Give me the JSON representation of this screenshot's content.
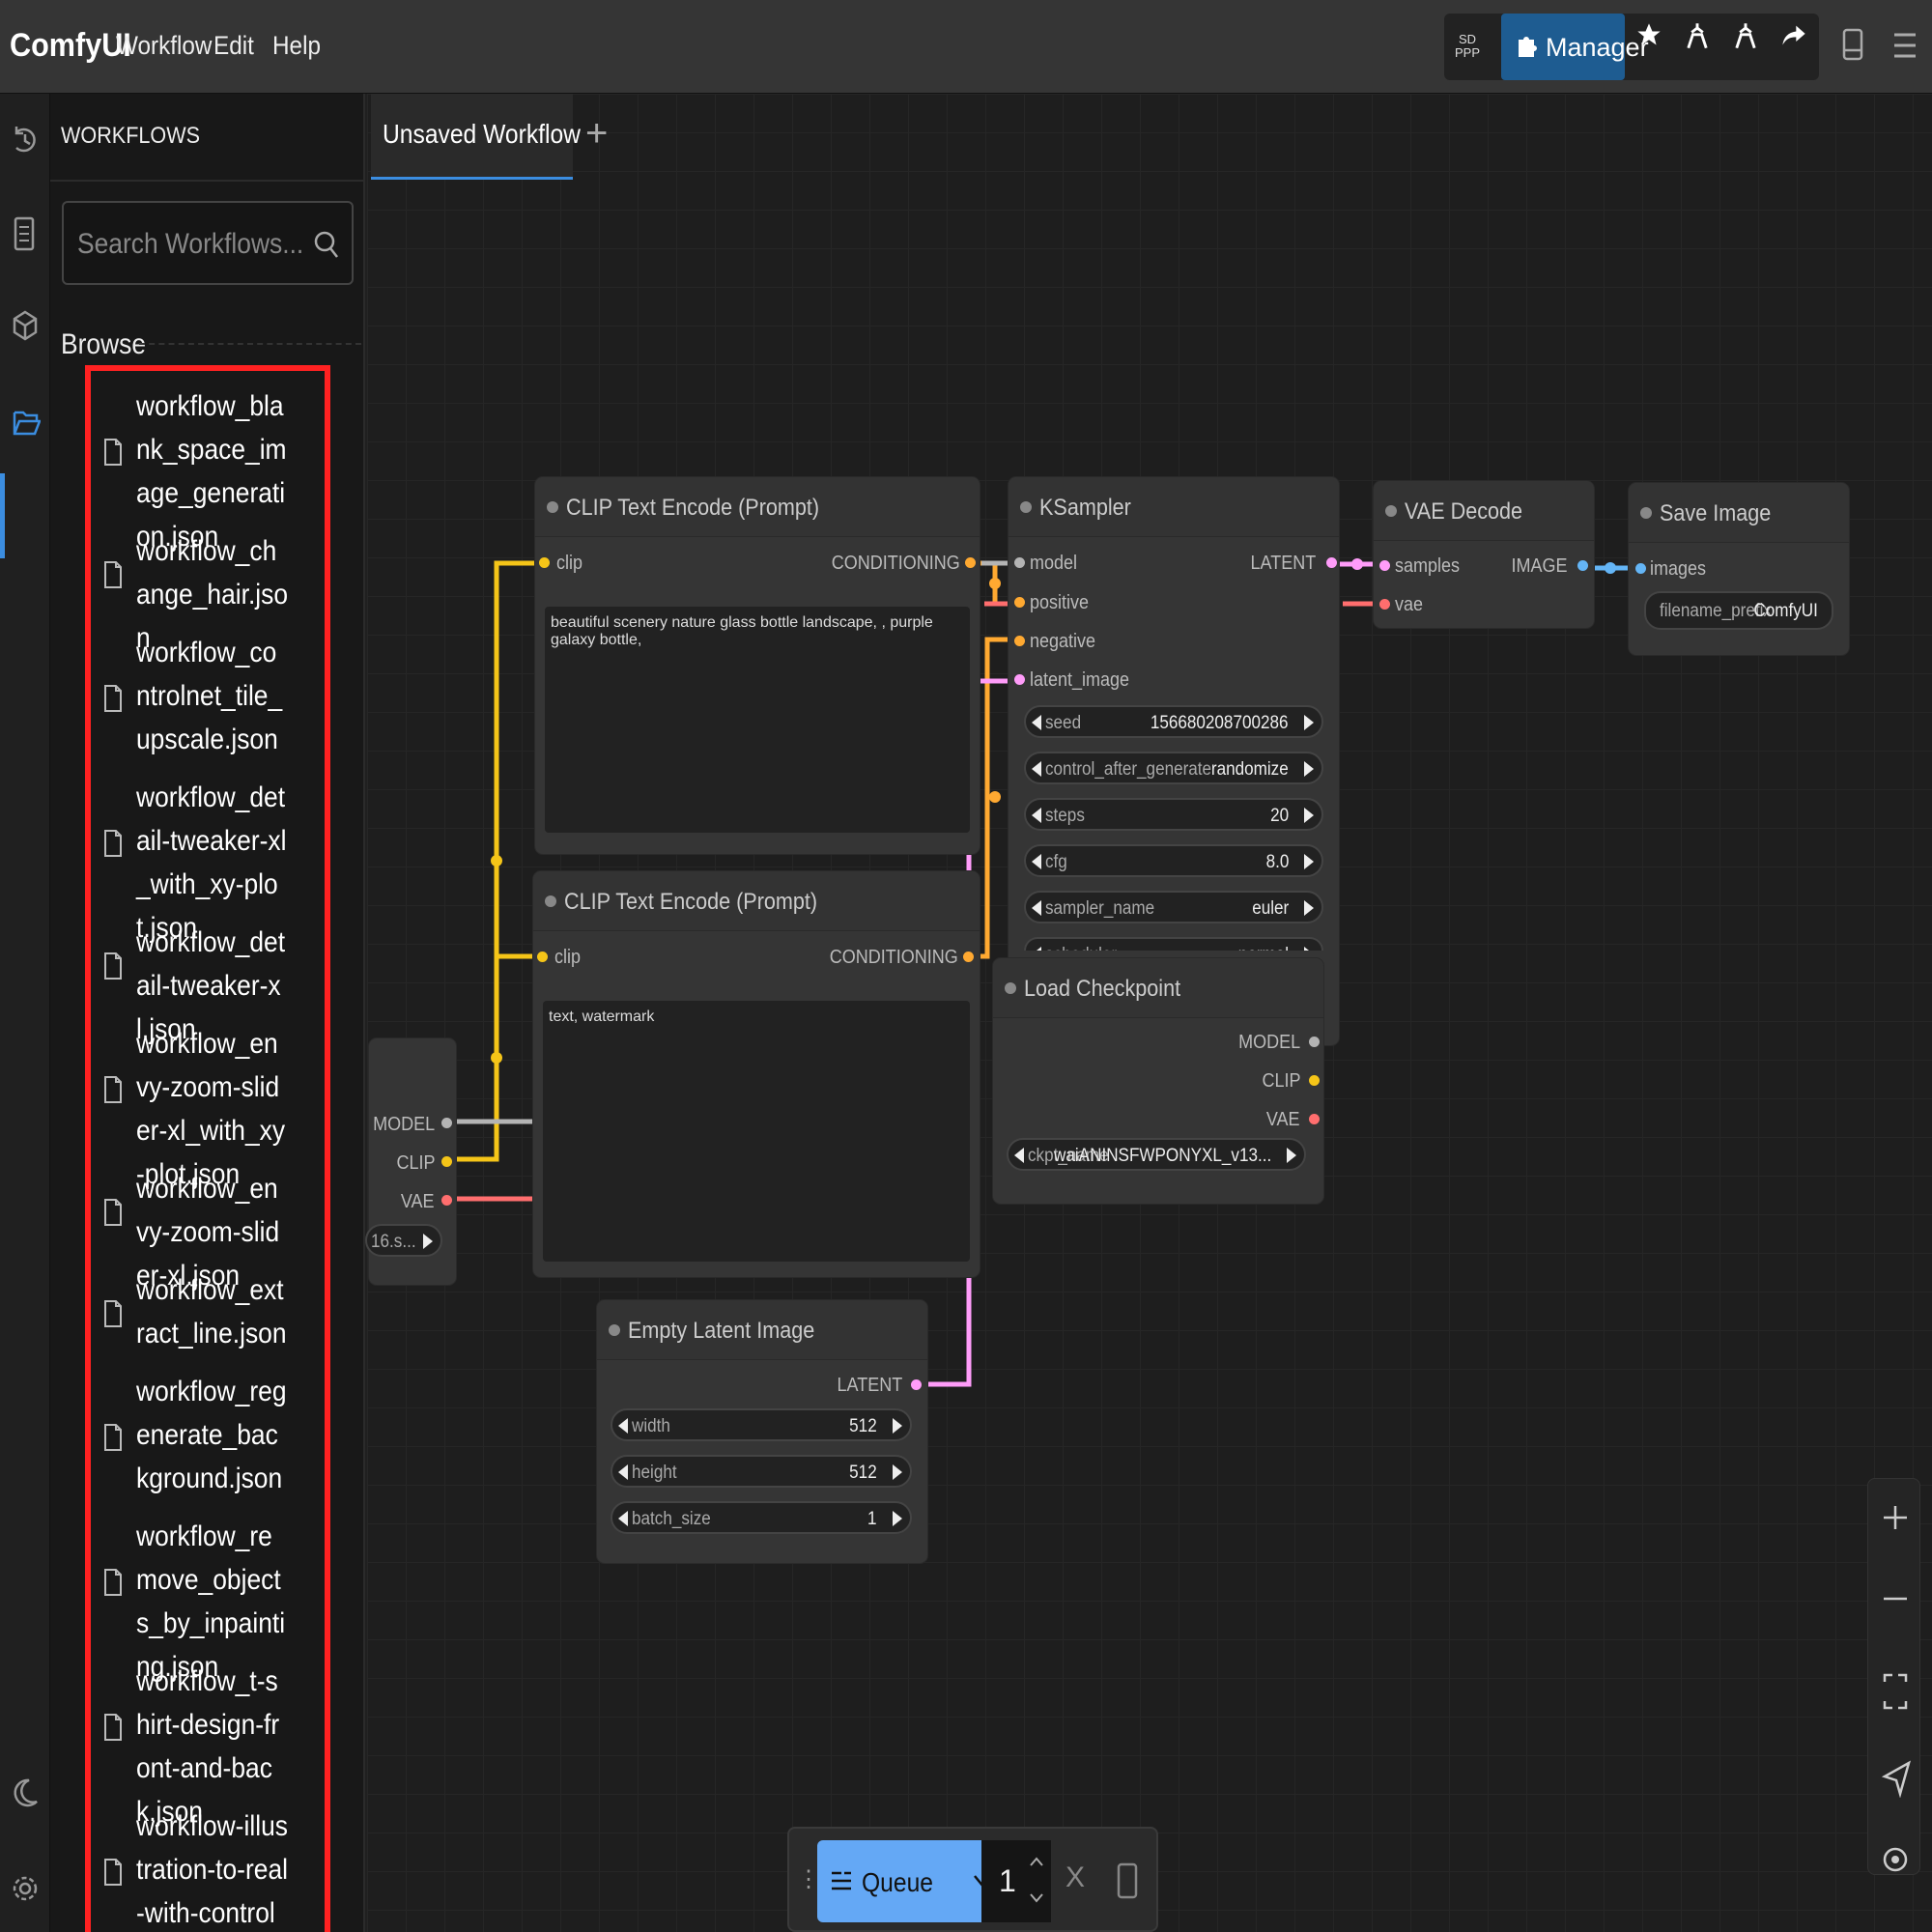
{
  "app": {
    "title": "ComfyUI"
  },
  "menu": {
    "workflow": "Workflow",
    "edit": "Edit",
    "help": "Help"
  },
  "toolbar": {
    "sdppp": "SD PPP",
    "manager": "Manager"
  },
  "sidebar": {
    "title": "WORKFLOWS",
    "search_placeholder": "Search Workflows...",
    "browse_label": "Browse",
    "workflows": [
      "workflow_blank_space_image_generation.json",
      "workflow_change_hair.json",
      "workflow_controlnet_tile_upscale.json",
      "workflow_detail-tweaker-xl_with_xy-plot.json",
      "workflow_detail-tweaker-xl.json",
      "workflow_envy-zoom-slider-xl_with_xy-plot.json",
      "workflow_envy-zoom-slider-xl.json",
      "workflow_extract_line.json",
      "workflow_regenerate_background.json",
      "workflow_remove_objects_by_inpainting.json",
      "workflow_t-shirt-design-front-and-back.json",
      "workflow-illustration-to-real-with-controlnet.json"
    ]
  },
  "tabs": {
    "active": "Unsaved Workflow"
  },
  "nodes": {
    "clip1": {
      "title": "CLIP Text Encode (Prompt)",
      "in": "clip",
      "out": "CONDITIONING",
      "text": "beautiful scenery nature glass bottle landscape, , purple galaxy bottle,"
    },
    "clip2": {
      "title": "CLIP Text Encode (Prompt)",
      "in": "clip",
      "out": "CONDITIONING",
      "text": "text, watermark"
    },
    "ksampler": {
      "title": "KSampler",
      "inputs": [
        "model",
        "positive",
        "negative",
        "latent_image"
      ],
      "out": "LATENT",
      "widgets": [
        {
          "label": "seed",
          "value": "156680208700286"
        },
        {
          "label": "control_after_generate",
          "value": "randomize"
        },
        {
          "label": "steps",
          "value": "20"
        },
        {
          "label": "cfg",
          "value": "8.0"
        },
        {
          "label": "sampler_name",
          "value": "euler"
        },
        {
          "label": "scheduler",
          "value": "normal"
        }
      ]
    },
    "vae_decode": {
      "title": "VAE Decode",
      "inputs": [
        "samples",
        "vae"
      ],
      "out": "IMAGE"
    },
    "save_image": {
      "title": "Save Image",
      "input": "images",
      "widget_label": "filename_prefix",
      "widget_value": "ComfyUI"
    },
    "load_checkpoint": {
      "title": "Load Checkpoint",
      "outputs": [
        "MODEL",
        "CLIP",
        "VAE"
      ],
      "widget_label": "ckpt_name",
      "widget_value": "waiANINSFWPONYXL_v13..."
    },
    "hidden_node": {
      "outputs": [
        "MODEL",
        "CLIP",
        "VAE"
      ],
      "widget_value": "16.s..."
    },
    "empty_latent": {
      "title": "Empty Latent Image",
      "out": "LATENT",
      "widgets": [
        {
          "label": "width",
          "value": "512"
        },
        {
          "label": "height",
          "value": "512"
        },
        {
          "label": "batch_size",
          "value": "1"
        }
      ]
    }
  },
  "queue": {
    "label": "Queue",
    "count": "1",
    "cancel": "X"
  },
  "colors": {
    "clip": "#f5c518",
    "conditioning": "#ffa931",
    "model": "#b4b4b4",
    "vae": "#ff6e6e",
    "latent": "#ff9cf9",
    "image": "#64b5f6",
    "accent": "#3b8de0",
    "highlight": "#ff2121"
  }
}
